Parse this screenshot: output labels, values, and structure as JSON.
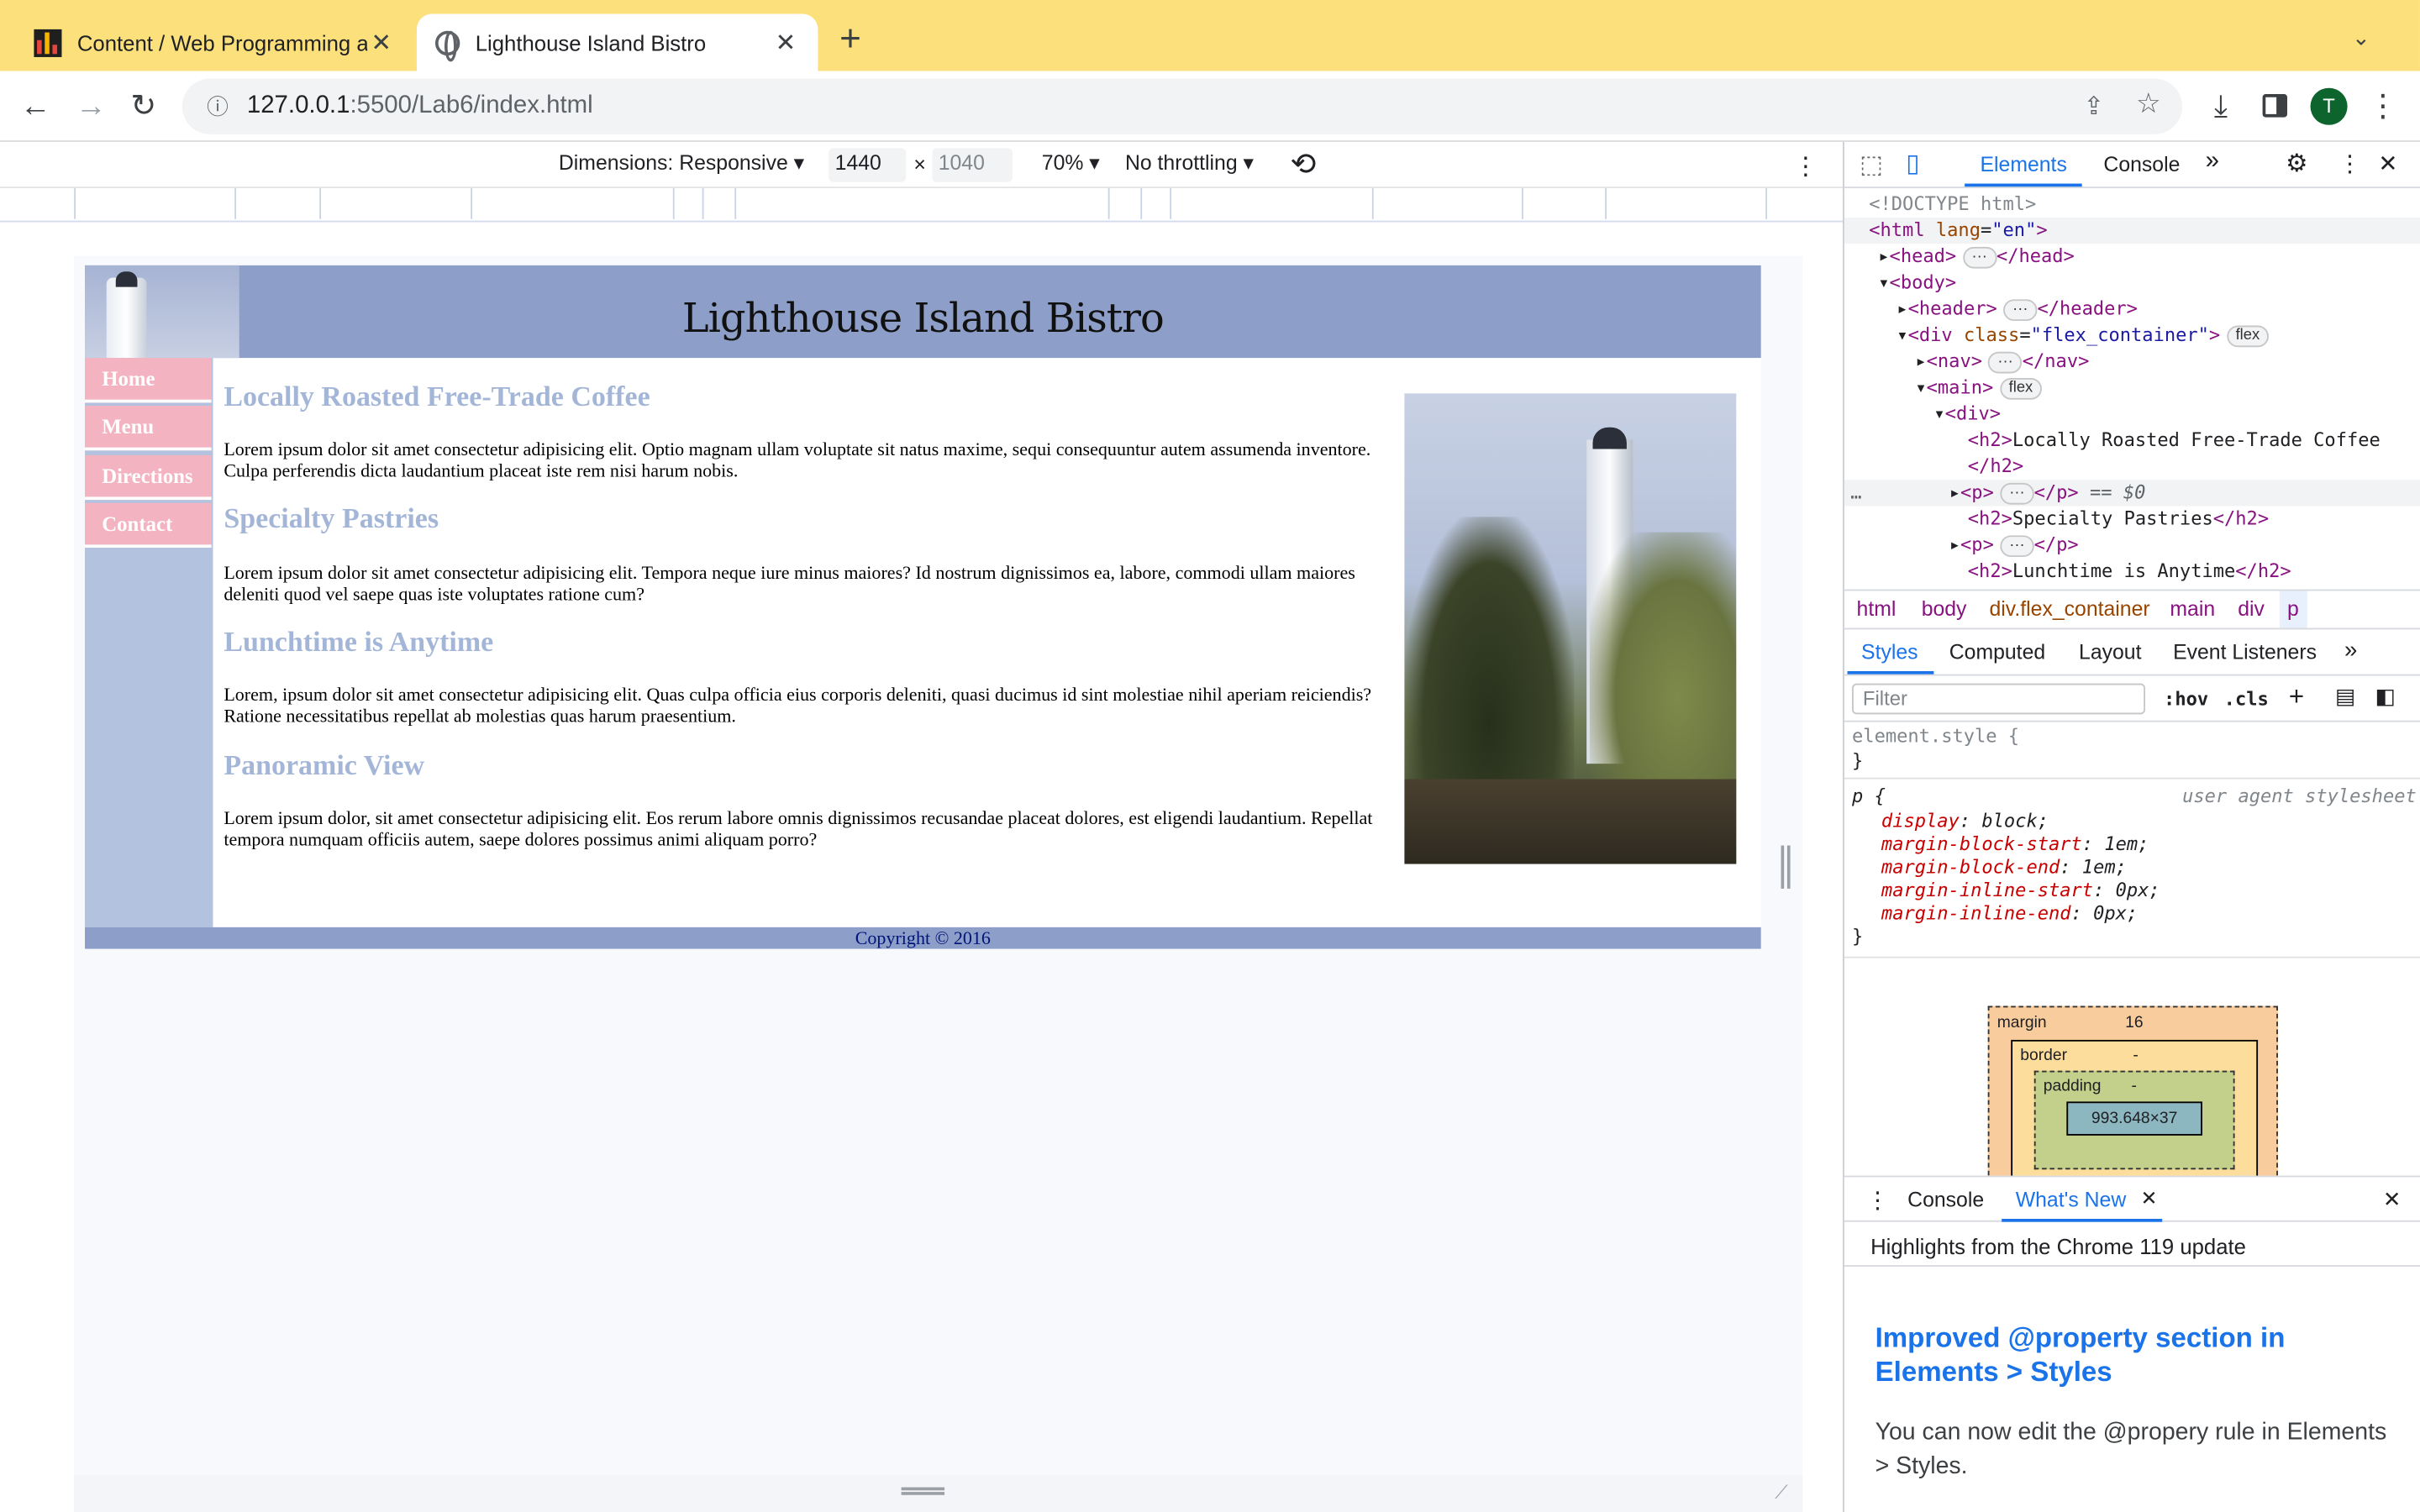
{
  "browser": {
    "tabs": [
      {
        "title": "Content / Web Programming a",
        "active": false
      },
      {
        "title": "Lighthouse Island Bistro",
        "active": true
      }
    ],
    "address": {
      "host": "127.0.0.1",
      "path": ":5500/Lab6/index.html"
    },
    "avatar_letter": "T"
  },
  "device_toolbar": {
    "dimensions": "Dimensions: Responsive",
    "width": "1440",
    "times": "×",
    "height": "1040",
    "zoom": "70%",
    "throttling": "No throttling"
  },
  "site": {
    "title": "Lighthouse Island Bistro",
    "nav": [
      "Home",
      "Menu",
      "Directions",
      "Contact"
    ],
    "sections": [
      {
        "heading": "Locally Roasted Free-Trade Coffee",
        "text": "Lorem ipsum dolor sit amet consectetur adipisicing elit. Optio magnam ullam voluptate sit natus maxime, sequi consequuntur autem assumenda inventore. Culpa perferendis dicta laudantium placeat iste rem nisi harum nobis."
      },
      {
        "heading": "Specialty Pastries",
        "text": "Lorem ipsum dolor sit amet consectetur adipisicing elit. Tempora neque iure minus maiores? Id nostrum dignissimos ea, labore, commodi ullam maiores deleniti quod vel saepe quas iste voluptates ratione cum?"
      },
      {
        "heading": "Lunchtime is Anytime",
        "text": "Lorem, ipsum dolor sit amet consectetur adipisicing elit. Quas culpa officia eius corporis deleniti, quasi ducimus id sint molestiae nihil aperiam reiciendis? Ratione necessitatibus repellat ab molestias quas harum praesentium."
      },
      {
        "heading": "Panoramic View",
        "text": "Lorem ipsum dolor, sit amet consectetur adipisicing elit. Eos rerum labore omnis dignissimos recusandae placeat dolores, est eligendi laudantium. Repellat tempora numquam officiis autem, saepe dolores possimus animi aliquam porro?"
      }
    ],
    "footer": "Copyright © 2016"
  },
  "devtools": {
    "tabs": [
      "Elements",
      "Console"
    ],
    "dom": {
      "doctype": "<!DOCTYPE html>",
      "html_tag": "<html",
      "lang_attr": "lang",
      "lang_val": "\"en\"",
      "head": "<head>",
      "head_close": "</head>",
      "body": "<body>",
      "header": "<header>",
      "header_close": "</header>",
      "div_open": "<div",
      "class_attr": "class",
      "class_val": "\"flex_container\"",
      "flex_badge": "flex",
      "nav": "<nav>",
      "nav_close": "</nav>",
      "main": "<main>",
      "inner_div": "<div>",
      "h2_open": "<h2>",
      "h2_text1": "Locally Roasted Free-Trade Coffee",
      "h2_close": "</h2>",
      "p_open": "<p>",
      "p_close": "</p>",
      "selected_marker": "== $0",
      "h2_text2": "Specialty Pastries",
      "h2_text3": "Lunchtime is Anytime",
      "ellipsis": "…"
    },
    "breadcrumbs": [
      "html",
      "body",
      "div.flex_container",
      "main",
      "div",
      "p"
    ],
    "subtabs": [
      "Styles",
      "Computed",
      "Layout",
      "Event Listeners"
    ],
    "filter_placeholder": "Filter",
    "hov": ":hov",
    "cls": ".cls",
    "styles": {
      "element_style": "element.style {",
      "close_brace": "}",
      "p_selector": "p {",
      "source": "user agent stylesheet",
      "rules": [
        {
          "prop": "display",
          "val": "block;"
        },
        {
          "prop": "margin-block-start",
          "val": "1em;"
        },
        {
          "prop": "margin-block-end",
          "val": "1em;"
        },
        {
          "prop": "margin-inline-start",
          "val": "0px;"
        },
        {
          "prop": "margin-inline-end",
          "val": "0px;"
        }
      ]
    },
    "boxmodel": {
      "margin_label": "margin",
      "margin_val": "16",
      "border_label": "border",
      "padding_label": "padding",
      "dash": "-",
      "content": "993.648×37"
    },
    "drawer": {
      "tabs": [
        "Console",
        "What's New"
      ],
      "highlights": "Highlights from the Chrome 119 update",
      "whatsnew_title": "Improved @property section in Elements > Styles",
      "whatsnew_body": "You can now edit the @propery rule in Elements > Styles."
    }
  },
  "colors": {
    "tabstrip": "#fbe07b",
    "site_header": "#8d9ec8",
    "nav_link": "#f4b3c1",
    "nav_bg": "#b3c3df",
    "heading": "#a4b6d8",
    "devtools_accent": "#1a73e8"
  }
}
